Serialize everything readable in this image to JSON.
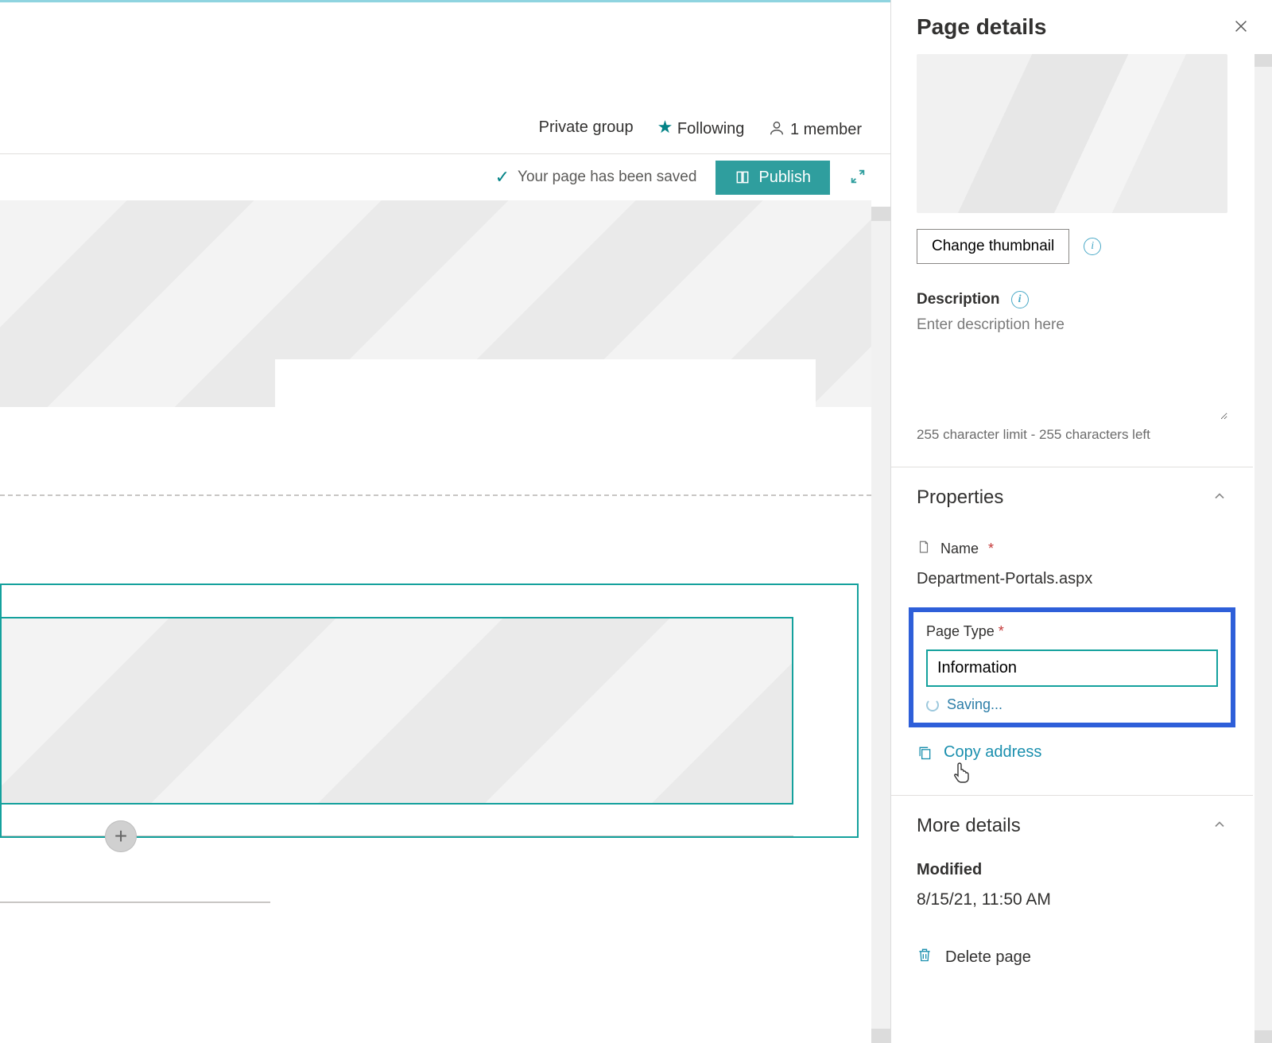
{
  "site_header": {
    "group_visibility": "Private group",
    "following_label": "Following",
    "members_label": "1 member"
  },
  "action_bar": {
    "saved_message": "Your page has been saved",
    "publish_label": "Publish"
  },
  "panel": {
    "title": "Page details",
    "change_thumbnail_label": "Change thumbnail",
    "description_label": "Description",
    "description_placeholder": "Enter description here",
    "description_char_note": "255 character limit - 255 characters left",
    "properties_heading": "Properties",
    "name_label": "Name",
    "name_value": "Department-Portals.aspx",
    "page_type_label": "Page Type",
    "page_type_value": "Information",
    "saving_label": "Saving...",
    "copy_address_label": "Copy address",
    "more_details_heading": "More details",
    "modified_label": "Modified",
    "modified_value": "8/15/21, 11:50 AM",
    "delete_label": "Delete page"
  }
}
